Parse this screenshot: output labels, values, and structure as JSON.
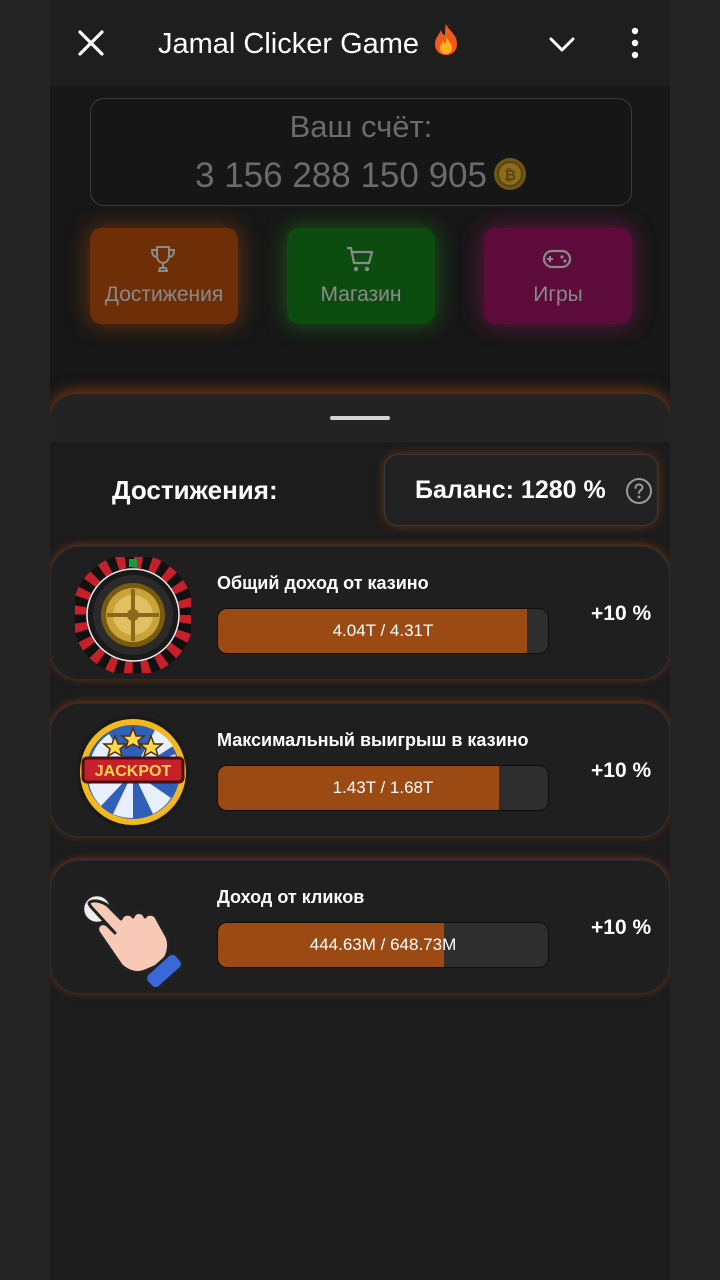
{
  "header": {
    "title": "Jamal Clicker Game",
    "title_emoji": "🔥"
  },
  "score": {
    "label": "Ваш счёт:",
    "value": "3 156 288 150 905"
  },
  "nav_buttons": [
    {
      "label": "Достижения",
      "icon": "trophy-icon",
      "color": "#6e2e06"
    },
    {
      "label": "Магазин",
      "icon": "cart-icon",
      "color": "#0c4d0f"
    },
    {
      "label": "Игры",
      "icon": "gamepad-icon",
      "color": "#5c0b3a"
    }
  ],
  "achievements": {
    "title": "Достижения:",
    "balance": "Баланс: 1280 %",
    "items": [
      {
        "name": "Общий доход от казино",
        "progress_text": "4.04T / 4.31T",
        "progress": 0.937,
        "bonus": "+10 %",
        "icon": "roulette-icon"
      },
      {
        "name": "Максимальный выигрыш в казино",
        "progress_text": "1.43T / 1.68T",
        "progress": 0.851,
        "bonus": "+10 %",
        "icon": "jackpot-icon"
      },
      {
        "name": "Доход от кликов",
        "progress_text": "444.63M / 648.73M",
        "progress": 0.685,
        "bonus": "+10 %",
        "icon": "tap-hand-icon"
      }
    ]
  },
  "colors": {
    "accent": "#9c4a14",
    "background": "#1c1c1c"
  }
}
